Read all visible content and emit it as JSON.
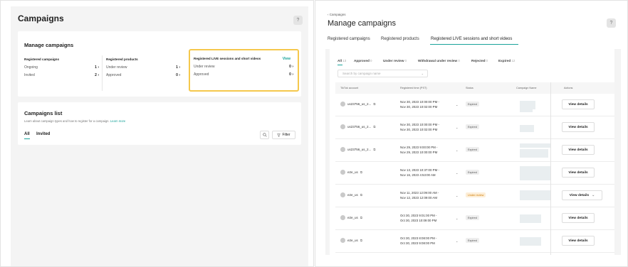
{
  "left": {
    "title": "Campaigns",
    "help": "?",
    "manage": {
      "title": "Manage campaigns",
      "columns": [
        {
          "title": "Registered campaigns",
          "rows": [
            {
              "label": "Ongoing",
              "value": "1 ›"
            },
            {
              "label": "Invited",
              "value": "2 ›"
            }
          ]
        },
        {
          "title": "Registered products",
          "rows": [
            {
              "label": "Under review",
              "value": "1 ›"
            },
            {
              "label": "Approved",
              "value": "0 ›"
            }
          ]
        },
        {
          "title": "Registered LIVE sessions and short videos",
          "view": "View",
          "rows": [
            {
              "label": "Under review",
              "value": "0 ›"
            },
            {
              "label": "Approved",
              "value": "0 ›"
            }
          ]
        }
      ]
    },
    "list": {
      "title": "Campaigns list",
      "subtitle": "Learn about campaign types and how to register for a campaign.",
      "learn_more": "Learn more",
      "tabs": [
        "All",
        "Invited"
      ],
      "filter": "Filter"
    }
  },
  "right": {
    "back": "‹ Campaigns",
    "title": "Manage campaigns",
    "help": "?",
    "tabs": [
      "Registered campaigns",
      "Registered products",
      "Registered LIVE sessions and short videos"
    ],
    "filter_tabs": [
      {
        "label": "All",
        "count": "13"
      },
      {
        "label": "Approved",
        "count": "0"
      },
      {
        "label": "Under review",
        "count": "0"
      },
      {
        "label": "Withdrawal under review",
        "count": "0"
      },
      {
        "label": "Rejected",
        "count": "0"
      },
      {
        "label": "Expired",
        "count": "12"
      }
    ],
    "search_placeholder": "Search by campaign name",
    "columns": [
      "TikTok account",
      "Registered time (PST)",
      "Status",
      "Campaign Name",
      "Actions"
    ],
    "rows": [
      {
        "account": "us23756_us_2...",
        "start": "Nov 30, 2023 10:00:00 PM -",
        "end": "Nov 30, 2023 10:02:00 PM",
        "status": "Expired",
        "action": "View details"
      },
      {
        "account": "us23756_us_2...",
        "start": "Nov 30, 2023 10:00:00 PM -",
        "end": "Nov 30, 2023 10:02:00 PM",
        "status": "Expired",
        "action": "View details"
      },
      {
        "account": "us23756_us_2...",
        "start": "Nov 29, 2023 9:00:00 PM -",
        "end": "Nov 29, 2023 10:00:00 PM",
        "status": "Expired",
        "action": "View details"
      },
      {
        "account": "e2e_us",
        "start": "Nov 13, 2023 10:37:00 PM -",
        "end": "Nov 16, 2023 4:53:00 AM",
        "status": "Expired",
        "action": "View details"
      },
      {
        "account": "e2e_us",
        "start": "Nov 11, 2023 12:09:00 AM -",
        "end": "Nov 12, 2023 12:09:00 AM",
        "status": "Under review",
        "action": "View details"
      },
      {
        "account": "e2e_us",
        "start": "Oct 30, 2023 9:01:00 PM -",
        "end": "Oct 30, 2023 10:09:00 PM",
        "status": "Expired",
        "action": "View details"
      },
      {
        "account": "e2e_us",
        "start": "Oct 30, 2023 8:08:00 PM -",
        "end": "Oct 30, 2023 9:08:00 PM",
        "status": "Expired",
        "action": "View details"
      }
    ]
  },
  "colors": {
    "accent": "#1aa39a",
    "highlight": "#f5c84c",
    "review": "#d07b00"
  }
}
